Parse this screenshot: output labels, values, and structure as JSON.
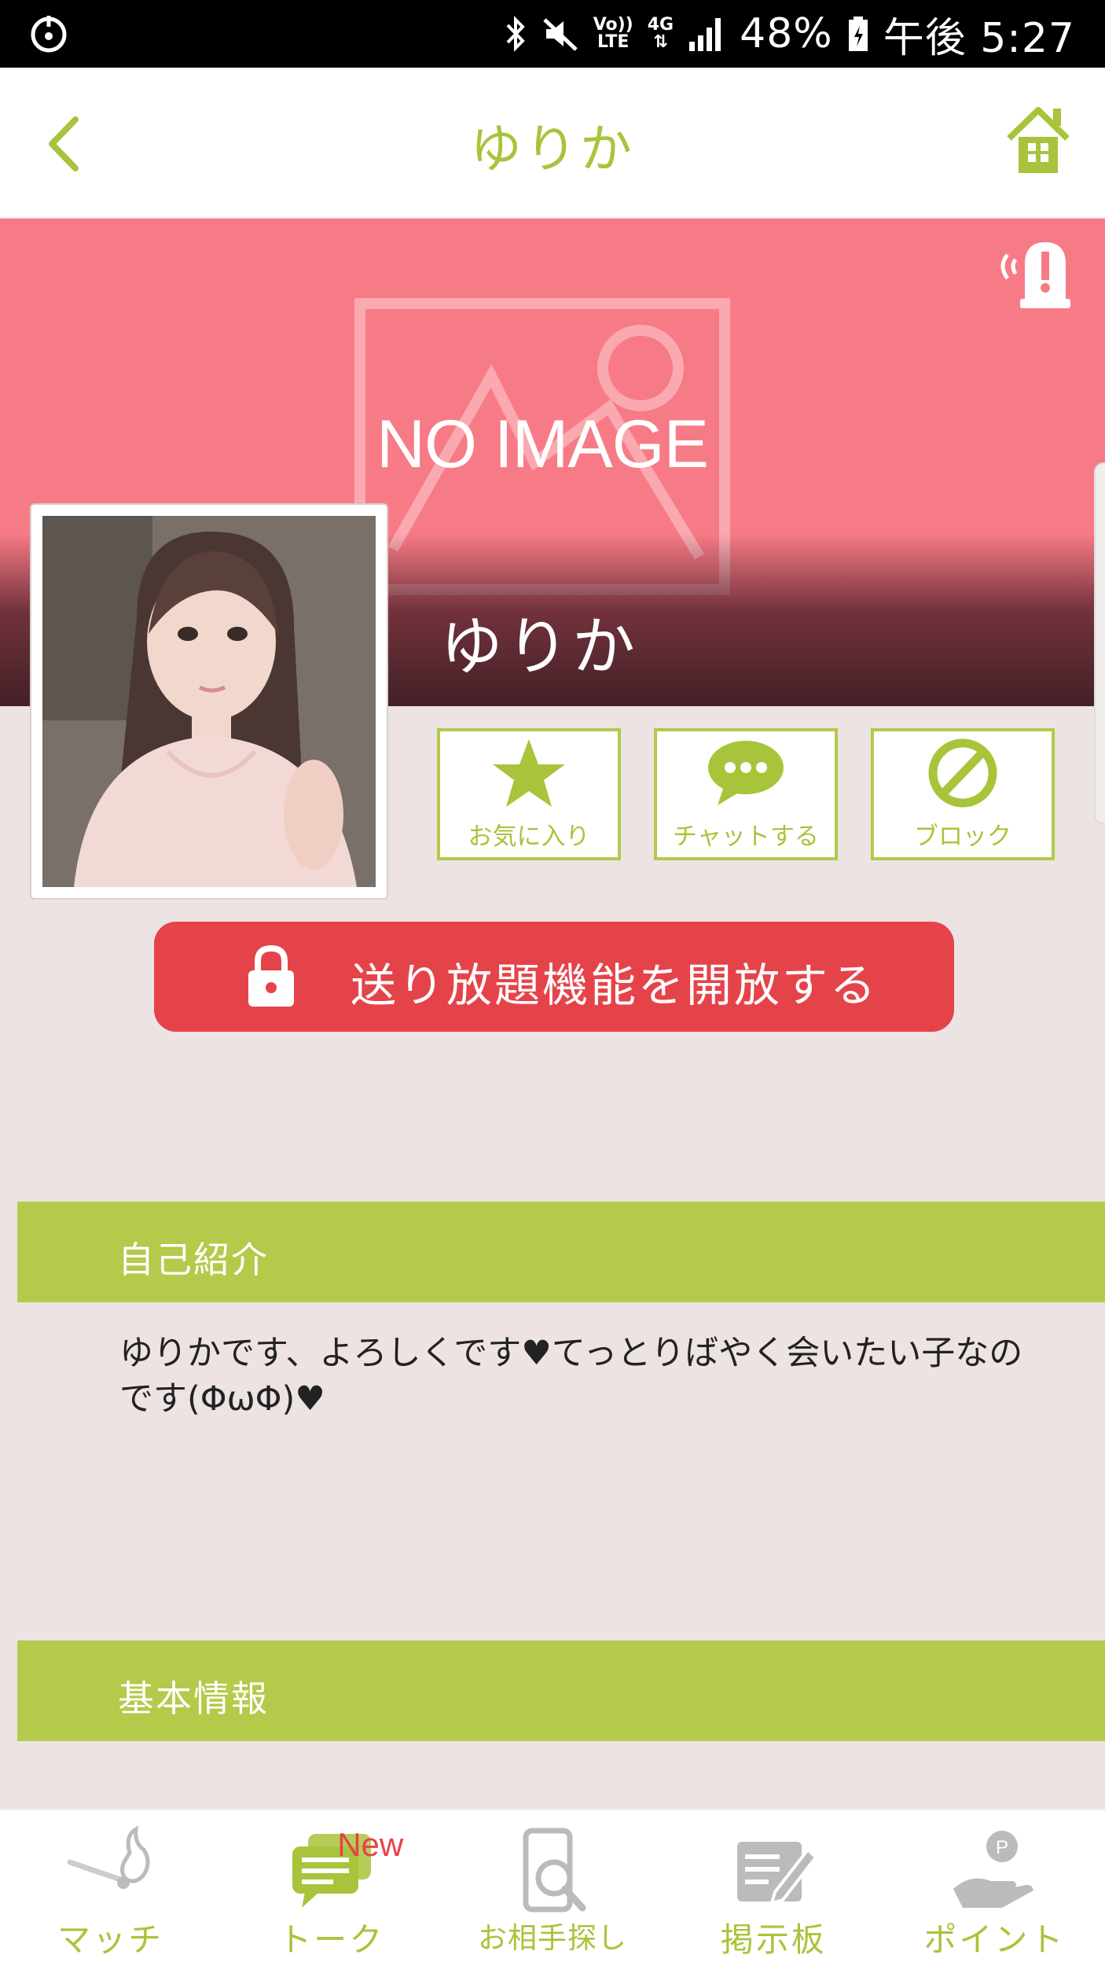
{
  "status_bar": {
    "network_top": "Vo))",
    "network_bottom": "LTE",
    "data_type": "4G",
    "battery": "48%",
    "time": "午後 5:27"
  },
  "header": {
    "title": "ゆりか"
  },
  "cover": {
    "placeholder_text": "NO IMAGE",
    "name": "ゆりか"
  },
  "actions": [
    {
      "label": "お気に入り",
      "icon": "star-icon"
    },
    {
      "label": "チャットする",
      "icon": "chat-bubble-icon"
    },
    {
      "label": "ブロック",
      "icon": "block-icon"
    }
  ],
  "unlock_button": {
    "label": "送り放題機能を開放する"
  },
  "sections": {
    "intro_title": "自己紹介",
    "intro_text": "ゆりかです、よろしくです♥てっとりばやく会いたい子なのです(ΦωΦ)♥",
    "basic_title": "基本情報"
  },
  "bottom_nav": [
    {
      "label": "マッチ",
      "icon": "match-icon"
    },
    {
      "label": "トーク",
      "icon": "talk-icon",
      "badge": "New"
    },
    {
      "label": "お相手探し",
      "icon": "search-partner-icon"
    },
    {
      "label": "掲示板",
      "icon": "board-icon"
    },
    {
      "label": "ポイント",
      "icon": "point-icon"
    }
  ],
  "colors": {
    "accent_green": "#a8c43a",
    "cover_pink": "#f77b86",
    "unlock_red": "#e5434a",
    "background": "#ede3e3"
  }
}
